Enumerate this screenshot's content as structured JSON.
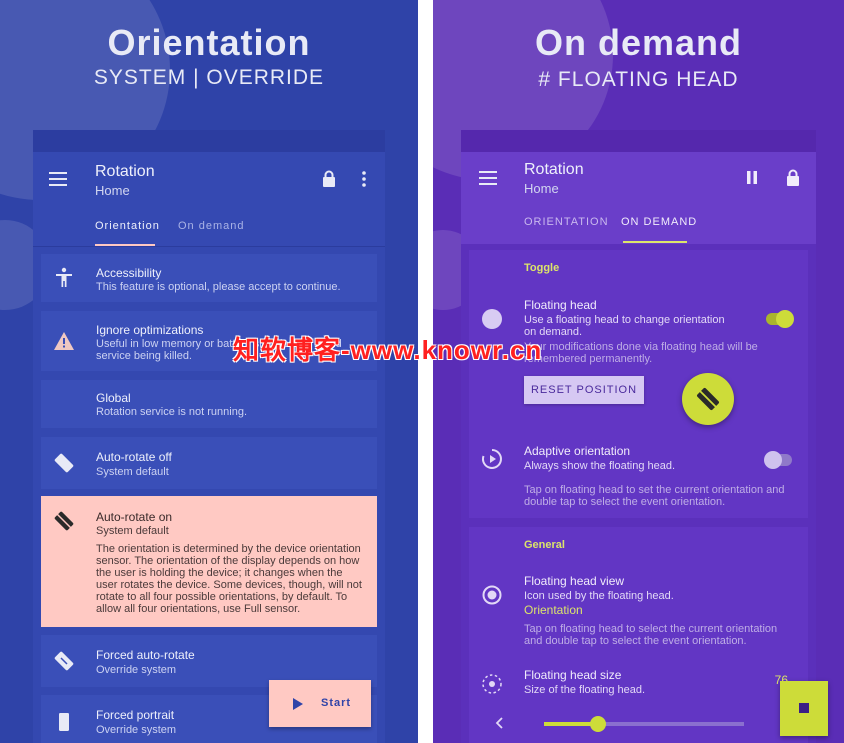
{
  "left": {
    "hero_title": "Orientation",
    "hero_sub": "SYSTEM | OVERRIDE",
    "appbar": {
      "title": "Rotation",
      "subtitle": "Home"
    },
    "tabs": [
      {
        "label": "Orientation",
        "active": true
      },
      {
        "label": "On demand",
        "active": false
      }
    ],
    "items": [
      {
        "icon": "accessibility-icon",
        "title": "Accessibility",
        "desc": [
          "This feature is optional, please accept to continue."
        ]
      },
      {
        "icon": "warning-icon",
        "title": "Ignore optimizations",
        "desc": [
          "Useful in low memory or battery situations to avoid",
          "service being killed."
        ]
      },
      {
        "icon": "",
        "title": "Global",
        "desc": [
          "Rotation service is not running."
        ]
      },
      {
        "icon": "phone-rotate-off-icon",
        "title": "Auto-rotate off",
        "desc": [
          "System default"
        ]
      },
      {
        "icon": "phone-rotate-on-icon",
        "title": "Auto-rotate on",
        "desc": [
          "System default",
          "",
          "The orientation is determined by the device orientation",
          "sensor. The orientation of the display depends on how",
          "the user is holding the device; it changes when the",
          "user rotates the device. Some devices, though, will not",
          "rotate to all four possible orientations, by default. To",
          "allow all four orientations, use Full sensor."
        ]
      },
      {
        "icon": "forced-rotate-icon",
        "title": "Forced auto-rotate",
        "desc": [
          "Override system"
        ]
      },
      {
        "icon": "portrait-icon",
        "title": "Forced portrait",
        "desc": [
          "Override system"
        ]
      }
    ],
    "start_label": "Start"
  },
  "right": {
    "hero_title": "On demand",
    "hero_sub": "# FLOATING HEAD",
    "appbar": {
      "title": "Rotation",
      "subtitle": "Home"
    },
    "tabs": [
      {
        "label": "ORIENTATION",
        "active": false
      },
      {
        "label": "ON DEMAND",
        "active": true
      }
    ],
    "toggle_section": {
      "title": "Toggle",
      "floating_head": {
        "title": "Floating head",
        "desc": [
          "Use a floating head to change orientation",
          "on demand."
        ],
        "note": [
          "Your modifications done via floating head will be",
          "remembered permanently."
        ],
        "enabled": true
      },
      "reset_label": "RESET POSITION",
      "adaptive": {
        "title": "Adaptive orientation",
        "desc": "Always show the floating head.",
        "note": [
          "Tap on floating head to set the current orientation and",
          "double tap to select the event orientation."
        ],
        "enabled": false
      }
    },
    "general_section": {
      "title": "General",
      "view": {
        "title": "Floating head view",
        "desc": "Icon used by the floating head.",
        "value": "Orientation",
        "note": [
          "Tap on floating head to select the current orientation",
          "and double tap to select the event orientation."
        ]
      },
      "size": {
        "title": "Floating head size",
        "desc": "Size of the floating head.",
        "value": "76",
        "slider_fraction": 0.27
      }
    }
  },
  "watermark": "知软博客-www.knowr.cn",
  "colors": {
    "left_bg": "#2f43a8",
    "right_bg": "#5a2db6",
    "highlight": "#ffc9c3",
    "accent_lime": "#cddc39"
  }
}
